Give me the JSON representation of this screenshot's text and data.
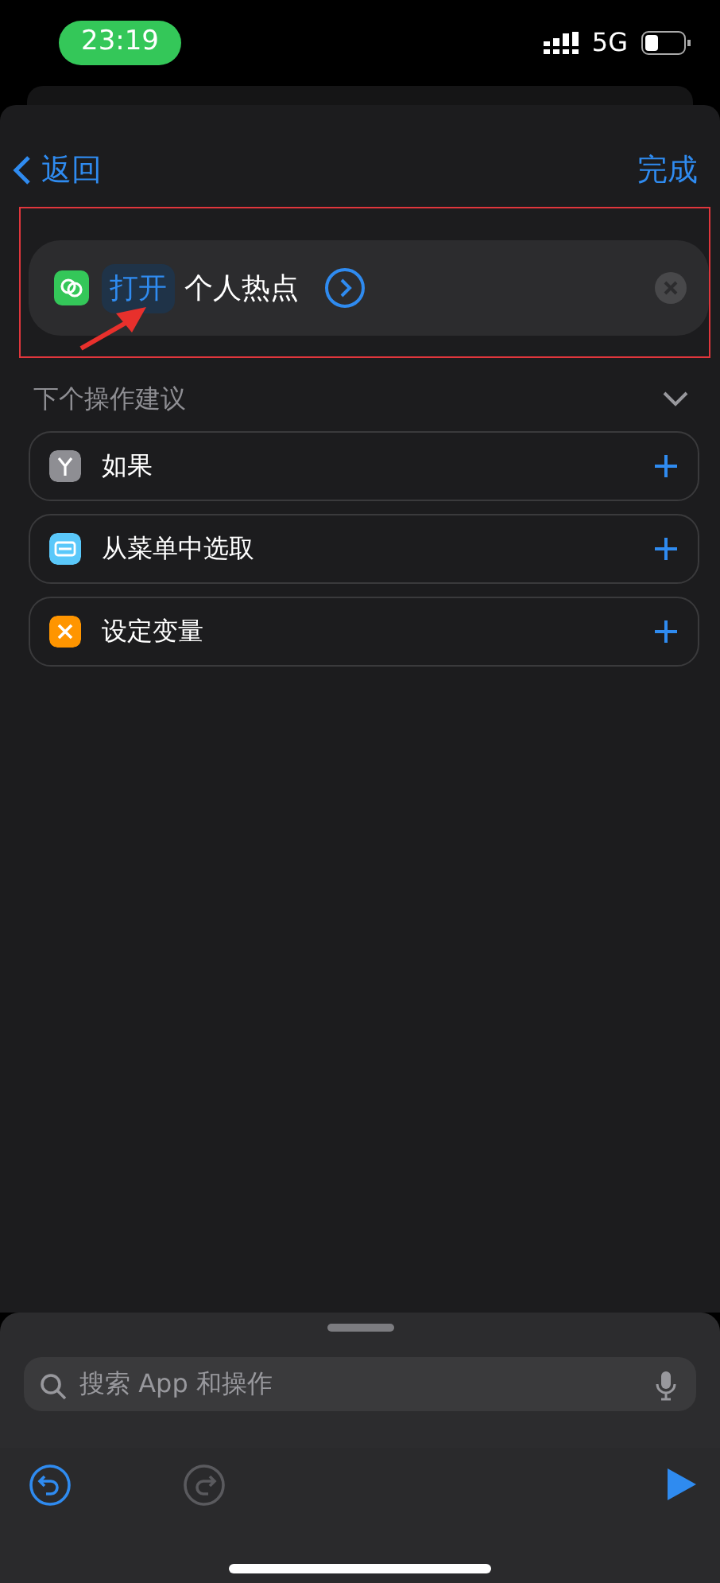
{
  "status_bar": {
    "time": "23:19",
    "network": "5G"
  },
  "nav": {
    "back": "返回",
    "done": "完成"
  },
  "action": {
    "verb": "打开",
    "target": "个人热点"
  },
  "suggestions": {
    "title": "下个操作建议",
    "expanded": true,
    "items": [
      {
        "label": "如果",
        "color": "#8e8e93",
        "kind": "branch"
      },
      {
        "label": "从菜单中选取",
        "color": "#5ac8fa",
        "kind": "menu"
      },
      {
        "label": "设定变量",
        "color": "#ff9500",
        "kind": "variable"
      }
    ]
  },
  "search": {
    "placeholder": "搜索 App 和操作"
  },
  "toolbar": {
    "undo_disabled": false,
    "redo_disabled": true
  }
}
